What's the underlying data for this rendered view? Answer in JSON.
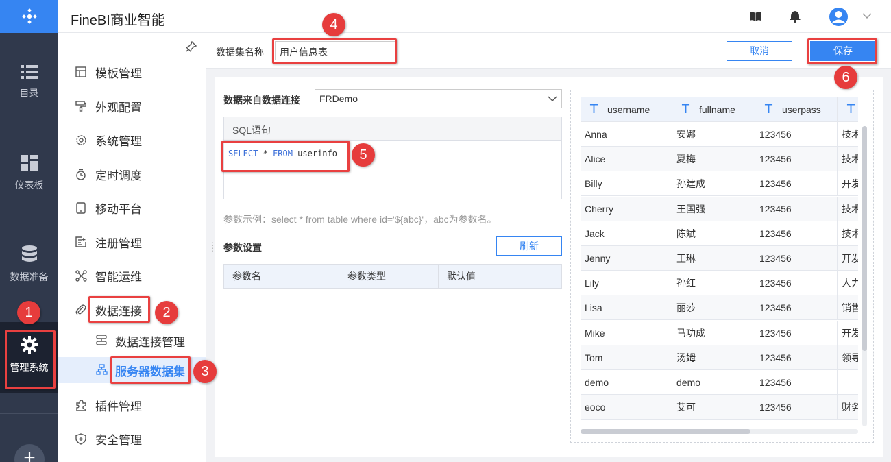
{
  "rail": {
    "items": [
      {
        "label": "目录",
        "icon": "list-icon"
      },
      {
        "label": "仪表板",
        "icon": "dashboard-icon"
      },
      {
        "label": "数据准备",
        "icon": "database-icon"
      },
      {
        "label": "管理系统",
        "icon": "gear-icon"
      }
    ],
    "add_label": "+"
  },
  "header": {
    "title": "FineBI商业智能"
  },
  "menu": {
    "items": [
      {
        "label": "模板管理",
        "icon": "template-icon"
      },
      {
        "label": "外观配置",
        "icon": "brush-icon"
      },
      {
        "label": "系统管理",
        "icon": "settings-icon"
      },
      {
        "label": "定时调度",
        "icon": "timer-icon"
      },
      {
        "label": "移动平台",
        "icon": "mobile-icon"
      },
      {
        "label": "注册管理",
        "icon": "register-icon"
      },
      {
        "label": "智能运维",
        "icon": "ops-icon"
      },
      {
        "label": "数据连接",
        "icon": "link-icon"
      },
      {
        "label": "插件管理",
        "icon": "plugin-icon"
      },
      {
        "label": "安全管理",
        "icon": "shield-icon"
      }
    ],
    "sub_items": [
      {
        "label": "数据连接管理",
        "icon": "server-icon"
      },
      {
        "label": "服务器数据集",
        "icon": "dataset-icon"
      }
    ]
  },
  "toolbar": {
    "dataset_label": "数据集名称",
    "dataset_value": "用户信息表",
    "cancel_label": "取消",
    "save_label": "保存"
  },
  "editor": {
    "source_label": "数据来自数据连接",
    "source_value": "FRDemo",
    "sql_header": "SQL语句",
    "sql_kw1": "SELECT",
    "sql_mid": " * ",
    "sql_kw2": "FROM",
    "sql_tail": " userinfo",
    "param_hint": "参数示例：select * from table where id='${abc}'，abc为参数名。",
    "param_title": "参数设置",
    "refresh_label": "刷新",
    "param_columns": [
      "参数名",
      "参数类型",
      "默认值"
    ]
  },
  "preview": {
    "columns": [
      "username",
      "fullname",
      "userpass",
      ""
    ],
    "rows": [
      [
        "Anna",
        "安娜",
        "123456",
        "技术"
      ],
      [
        "Alice",
        "夏梅",
        "123456",
        "技术"
      ],
      [
        "Billy",
        "孙建成",
        "123456",
        "开发"
      ],
      [
        "Cherry",
        "王国强",
        "123456",
        "技术"
      ],
      [
        "Jack",
        "陈斌",
        "123456",
        "技术"
      ],
      [
        "Jenny",
        "王琳",
        "123456",
        "开发"
      ],
      [
        "Lily",
        "孙红",
        "123456",
        "人力"
      ],
      [
        "Lisa",
        "丽莎",
        "123456",
        "销售"
      ],
      [
        "Mike",
        "马功成",
        "123456",
        "开发"
      ],
      [
        "Tom",
        "汤姆",
        "123456",
        "领导"
      ],
      [
        "demo",
        "demo",
        "123456",
        ""
      ],
      [
        "eoco",
        "艾可",
        "123456",
        "财务"
      ]
    ]
  },
  "annotations": [
    "1",
    "2",
    "3",
    "4",
    "5",
    "6"
  ],
  "colors": {
    "accent": "#3685f2",
    "rail": "#30394c",
    "callout": "#e94040"
  }
}
